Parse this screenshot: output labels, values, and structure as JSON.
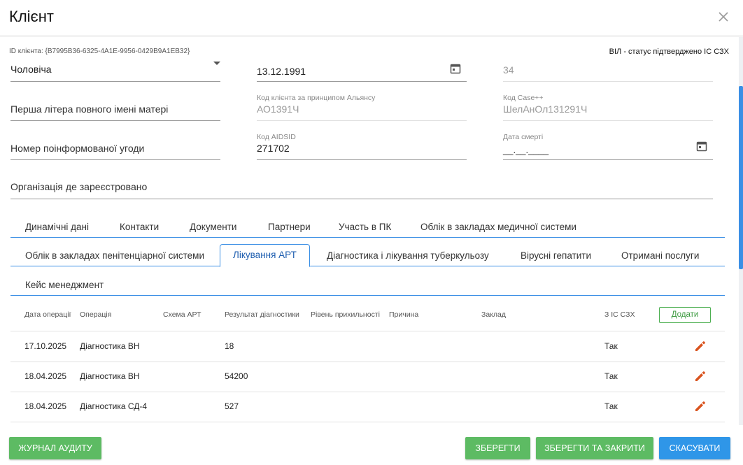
{
  "dialog": {
    "title": "Клієнт"
  },
  "client": {
    "id_text": "ID клієнта: {B7995B36-6325-4A1E-9956-0429B9A1EB32}",
    "vil_status": "ВІЛ - статус підтверджено ІС СЗХ"
  },
  "fields": {
    "gender": {
      "value": "Чоловіча"
    },
    "birth_date": {
      "value": "13.12.1991"
    },
    "age": {
      "value": "34"
    },
    "mother_letter": {
      "placeholder": "Перша літера повного імені матері"
    },
    "alliance_code": {
      "label": "Код клієнта за принципом Альянсу",
      "value": "АО1391Ч"
    },
    "case_code": {
      "label": "Код Case++",
      "value": "ШелАнОл131291Ч"
    },
    "consent_number": {
      "placeholder": "Номер поінформованої угоди"
    },
    "aidsid_code": {
      "label": "Код AIDSID",
      "value": "271702"
    },
    "death_date": {
      "label": "Дата смерті",
      "value": "__.__.____"
    },
    "organization": {
      "placeholder": "Організація де зареєстровано"
    }
  },
  "tabs": {
    "row1": [
      "Динамічні дані",
      "Контакти",
      "Документи",
      "Партнери",
      "Участь в ПК",
      "Облік в закладах медичної системи"
    ],
    "row2": [
      "Облік в закладах пенітенціарної системи",
      "Лікування АРТ",
      "Діагностика і лікування туберкульозу",
      "Вірусні гепатити",
      "Отримані послуги"
    ],
    "row3": [
      "Кейс менеджмент"
    ],
    "active": "Лікування АРТ"
  },
  "table": {
    "headers": [
      "Дата операції",
      "Операція",
      "Схема АРТ",
      "Результат діагностики",
      "Рівень прихильності",
      "Причина",
      "Заклад",
      "З ІС СЗХ"
    ],
    "add_label": "Додати",
    "rows": [
      {
        "date": "17.10.2025",
        "operation": "Діагностика ВН",
        "scheme": "",
        "result": "18",
        "adherence": "",
        "reason": "",
        "facility": "",
        "from_ic": "Так"
      },
      {
        "date": "18.04.2025",
        "operation": "Діагностика ВН",
        "scheme": "",
        "result": "54200",
        "adherence": "",
        "reason": "",
        "facility": "",
        "from_ic": "Так"
      },
      {
        "date": "18.04.2025",
        "operation": "Діагностика СД-4",
        "scheme": "",
        "result": "527",
        "adherence": "",
        "reason": "",
        "facility": "",
        "from_ic": "Так"
      }
    ]
  },
  "footer": {
    "audit": "ЖУРНАЛ АУДИТУ",
    "save": "ЗБЕРЕГТИ",
    "save_close": "ЗБЕРЕГТИ ТА ЗАКРИТИ",
    "cancel": "СКАСУВАТИ"
  },
  "colors": {
    "accent": "#3b8fe5",
    "green": "#5dbb63",
    "blue": "#2f96e8",
    "edit": "#d9531e"
  }
}
